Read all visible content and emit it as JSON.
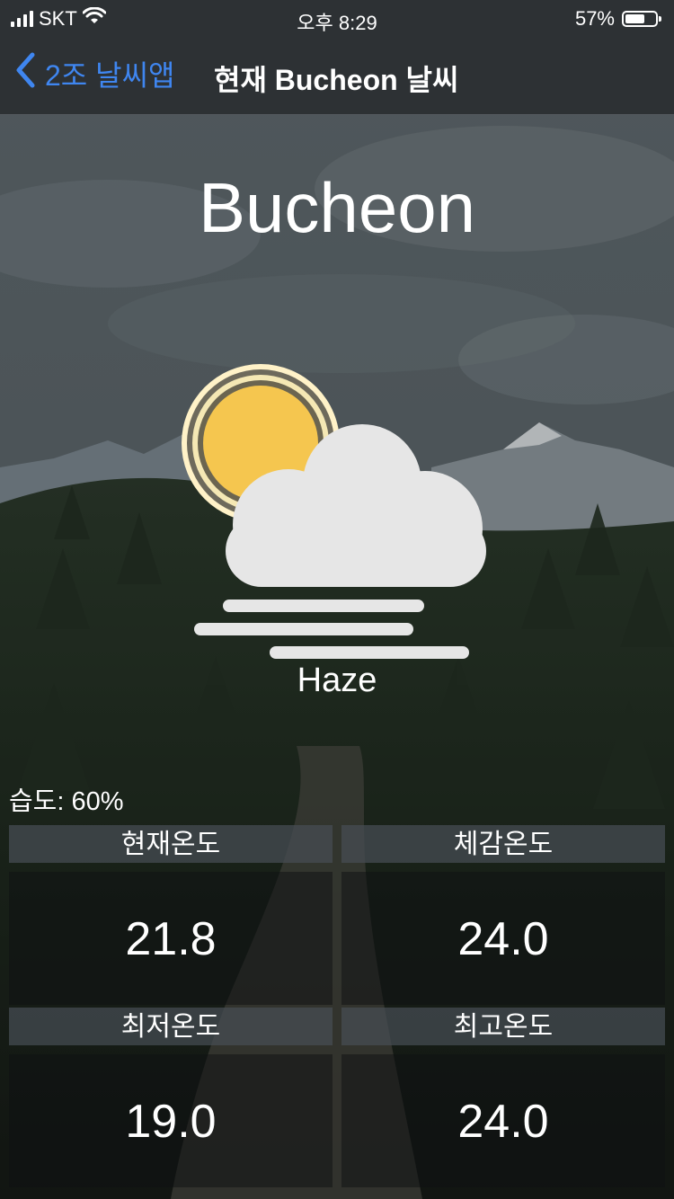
{
  "status_bar": {
    "carrier": "SKT",
    "time": "오후 8:29",
    "battery_percent": "57%",
    "battery_level": 0.57
  },
  "nav": {
    "back_label": "2조 날씨앱",
    "title": "현재 Bucheon 날씨"
  },
  "weather": {
    "city": "Bucheon",
    "condition": "Haze",
    "icon": "sun-cloud-haze-icon",
    "humidity_label": "습도: 60%"
  },
  "temps": {
    "current": {
      "label": "현재온도",
      "value": "21.8"
    },
    "feels_like": {
      "label": "체감온도",
      "value": "24.0"
    },
    "min": {
      "label": "최저온도",
      "value": "19.0"
    },
    "max": {
      "label": "최고온도",
      "value": "24.0"
    }
  },
  "colors": {
    "accent": "#3f86f0",
    "sun": "#f5c64f",
    "cloud": "#e6e6e6",
    "bar": "#2d3134"
  }
}
